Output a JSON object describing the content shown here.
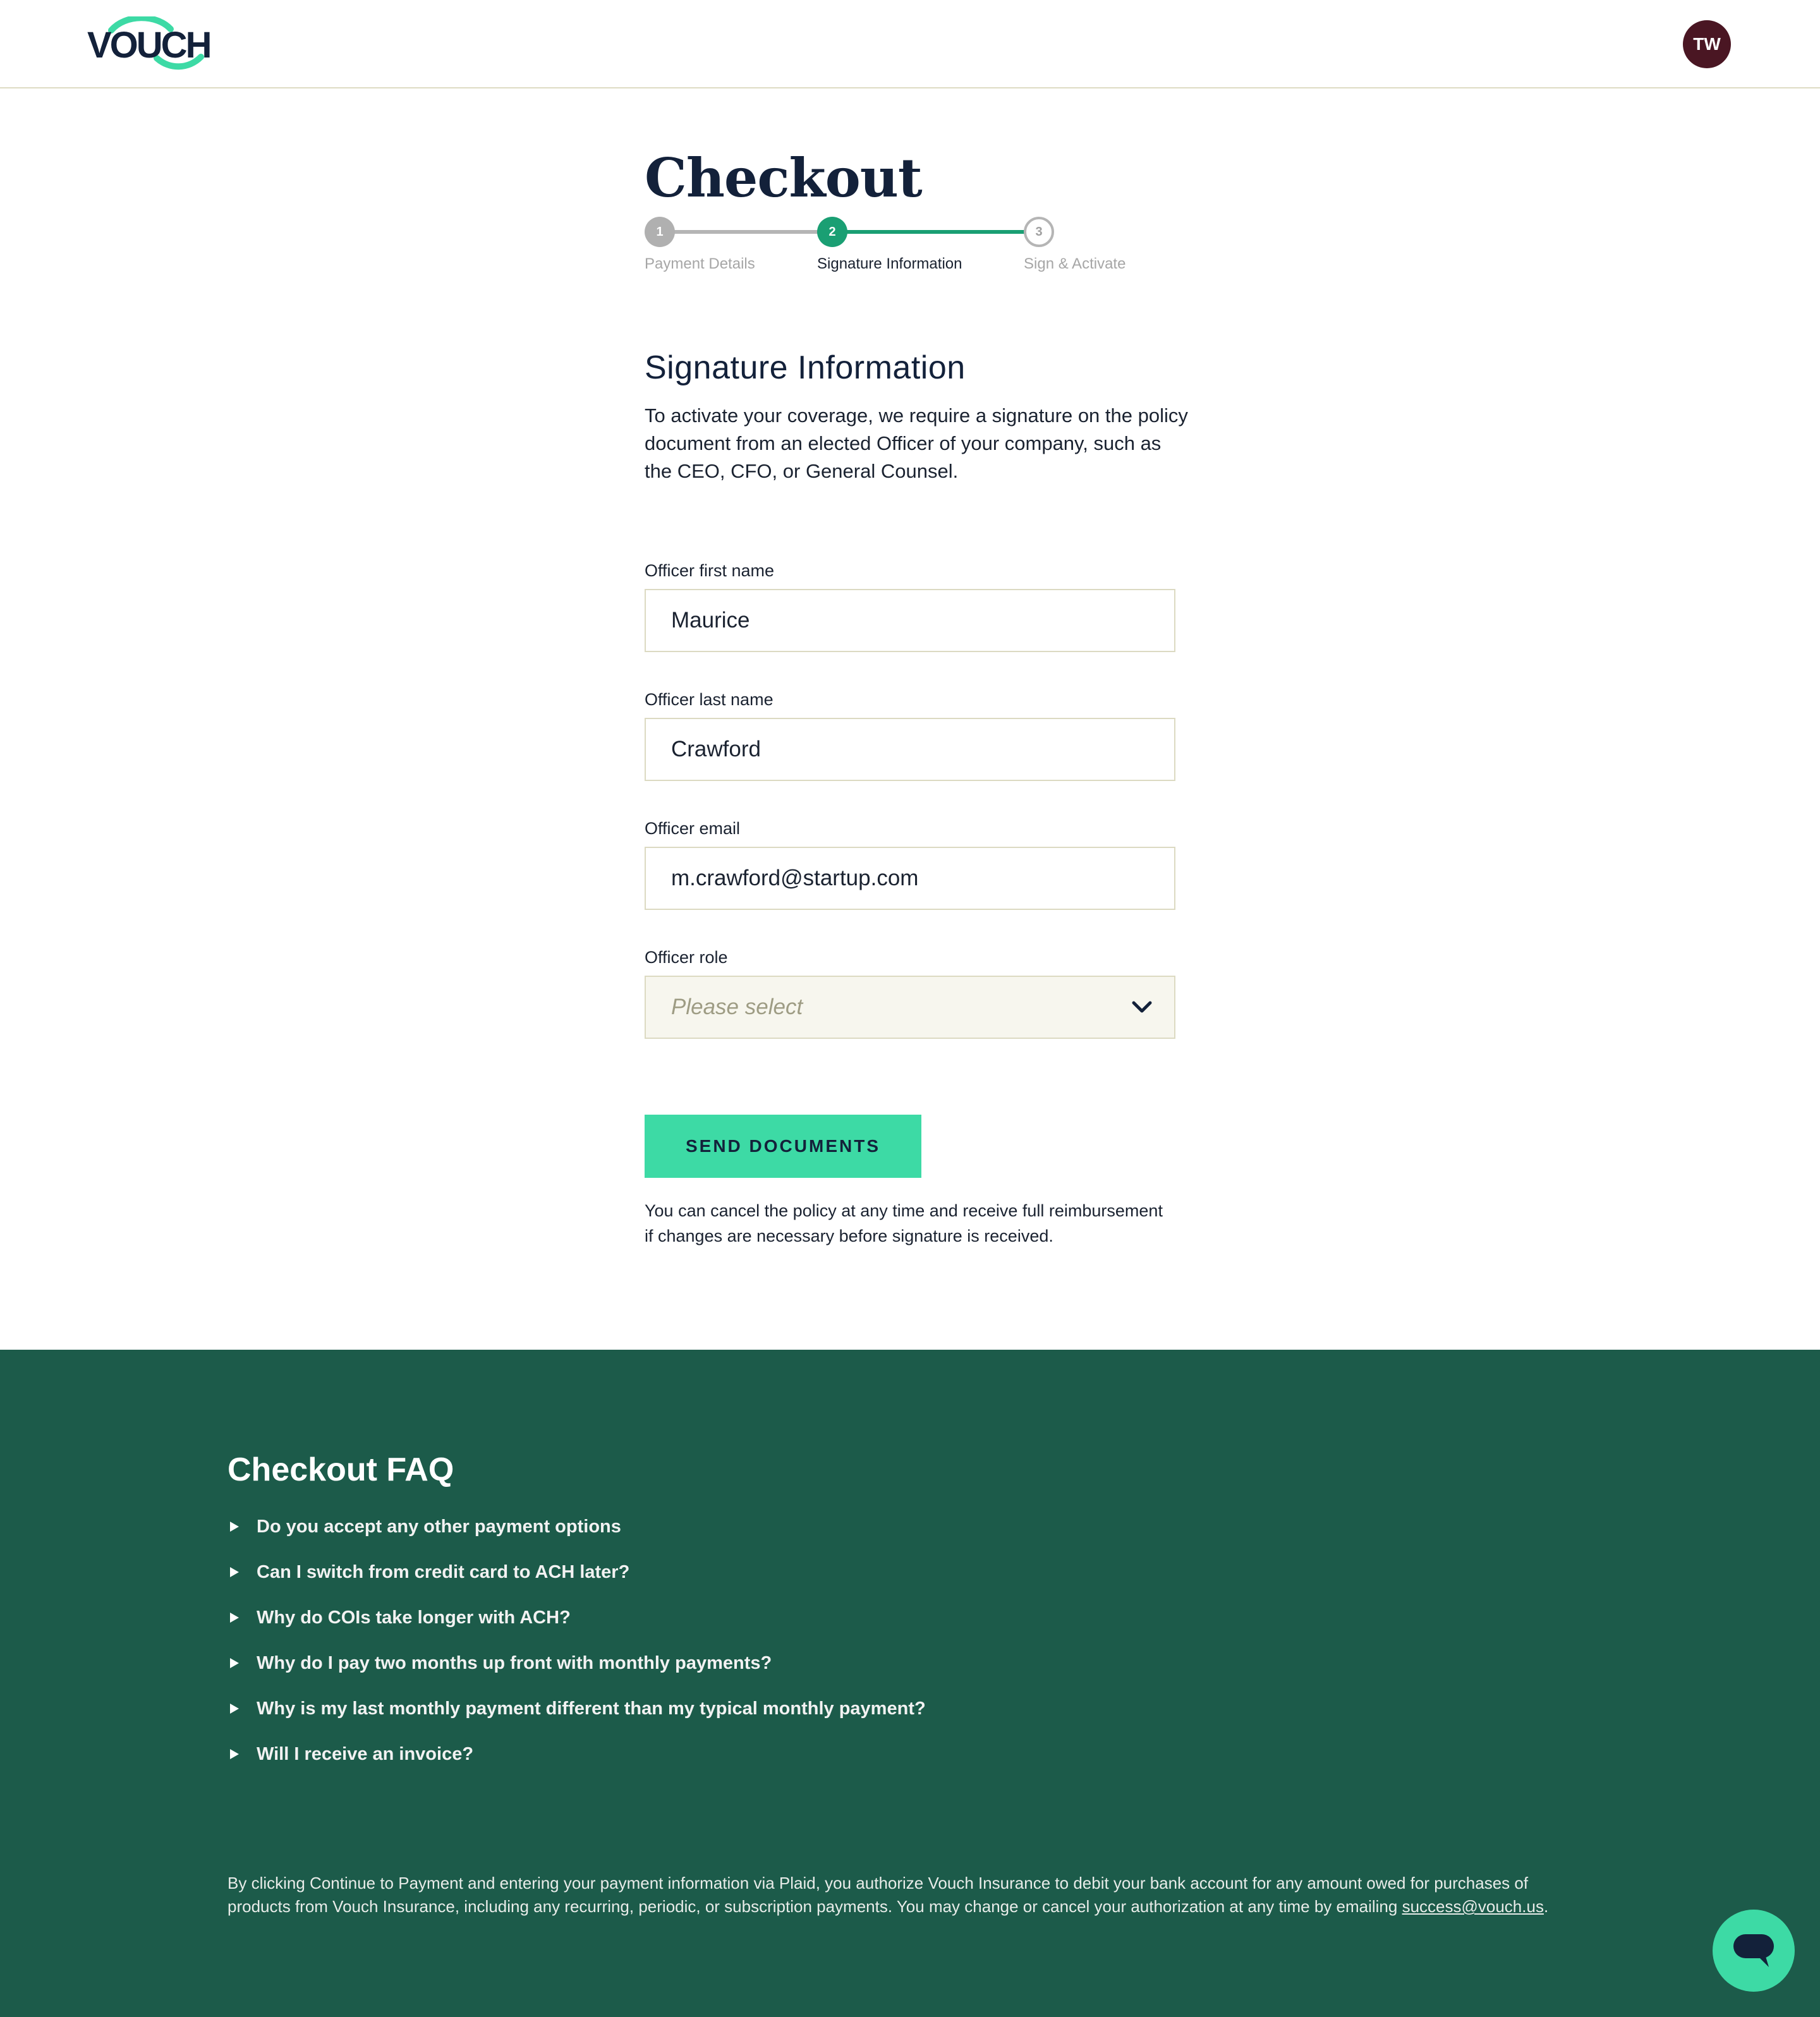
{
  "header": {
    "logo_text": "VOUCH",
    "avatar_initials": "TW"
  },
  "checkout": {
    "title": "Checkout",
    "steps": [
      {
        "number": "1",
        "label": "Payment Details",
        "state": "complete"
      },
      {
        "number": "2",
        "label": "Signature Information",
        "state": "current"
      },
      {
        "number": "3",
        "label": "Sign & Activate",
        "state": "upcoming"
      }
    ]
  },
  "signature": {
    "heading": "Signature Information",
    "description": "To activate your coverage, we require a signature on the policy document from an elected Officer of your company, such as the CEO, CFO, or General Counsel.",
    "first_name": {
      "label": "Officer first name",
      "value": "Maurice"
    },
    "last_name": {
      "label": "Officer last name",
      "value": "Crawford"
    },
    "email": {
      "label": "Officer email",
      "value": "m.crawford@startup.com"
    },
    "role": {
      "label": "Officer role",
      "placeholder": "Please select"
    },
    "send_button": "SEND DOCUMENTS",
    "cancel_note": "You can cancel the policy at any time and receive full reimbursement if changes are necessary before signature is received."
  },
  "faq": {
    "title": "Checkout FAQ",
    "items": [
      "Do you accept any other payment options",
      "Can I switch from credit card to ACH later?",
      "Why do COIs take longer with ACH?",
      "Why do I pay two months up front with monthly payments?",
      "Why is my last monthly payment different than my typical monthly payment?",
      "Will I receive an invoice?"
    ]
  },
  "legal": {
    "text": "By clicking Continue to Payment and entering your payment information via Plaid, you authorize Vouch Insurance to debit your bank account for any amount owed for purchases of products from Vouch Insurance, including any recurring, periodic, or subscription payments. You may change or cancel your authorization at any time by emailing ",
    "email_link": "success@vouch.us",
    "trailing": "."
  },
  "colors": {
    "accent": "#3ddaa5",
    "step_green": "#1a9f73",
    "footer_bg": "#1c5b4a",
    "avatar_bg": "#4a1623",
    "navy": "#13213a"
  },
  "icons": {
    "chevron": "chevron-down-icon",
    "caret": "caret-right-icon",
    "chat": "chat-bubble-icon"
  }
}
